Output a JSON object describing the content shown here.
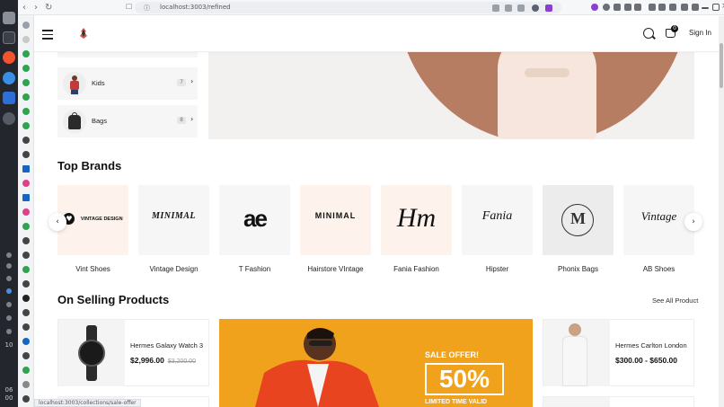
{
  "browser": {
    "url": "localhost:3003/refined",
    "status_url": "localhost:3003/collections/sale-offer"
  },
  "os": {
    "clock_line1": "10",
    "clock_line2": "06",
    "clock_line3": "00"
  },
  "header": {
    "signin_label": "Sign In",
    "cart_count": "0"
  },
  "categories": [
    {
      "label": "Kids",
      "count": "7"
    },
    {
      "label": "Bags",
      "count": "8"
    }
  ],
  "brands_section": {
    "title": "Top Brands",
    "brands": [
      {
        "name": "Vint Shoes",
        "logo_text": "VINTAGE DESIGN",
        "bg": "#fdf3ec"
      },
      {
        "name": "Vintage Design",
        "logo_text": "MINIMAL",
        "bg": "#f6f6f6"
      },
      {
        "name": "T Fashion",
        "logo_text": "ae",
        "bg": "#f6f6f6"
      },
      {
        "name": "Hairstore VIntage",
        "logo_text": "MINIMAL",
        "bg": "#fdf3ec"
      },
      {
        "name": "Fania Fashion",
        "logo_text": "Hm",
        "bg": "#fdf3ec"
      },
      {
        "name": "Hipster",
        "logo_text": "Fania",
        "bg": "#f6f6f6"
      },
      {
        "name": "Phonix Bags",
        "logo_text": "M",
        "bg": "#ececec"
      },
      {
        "name": "AB Shoes",
        "logo_text": "Vintage",
        "bg": "#f6f6f6"
      }
    ]
  },
  "products_section": {
    "title": "On Selling Products",
    "see_all_label": "See All Product",
    "products": [
      {
        "name": "Hermes Galaxy Watch 3",
        "price": "$2,996.00",
        "old_price": "$3,200.00"
      },
      {
        "name": "Hermes Carlton London",
        "price": "$300.00  -  $650.00",
        "old_price": ""
      }
    ],
    "sale_banner": {
      "headline": "SALE OFFER!",
      "percent": "50%",
      "sub": "LIMITED TIME VALID"
    }
  }
}
